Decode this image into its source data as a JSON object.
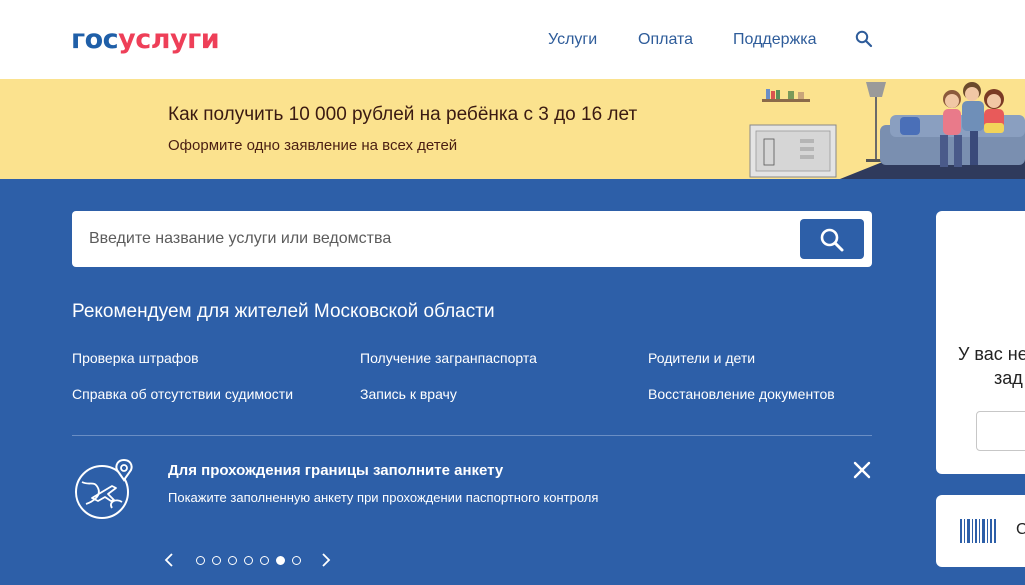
{
  "header": {
    "logo_part1": "гос",
    "logo_part2": "услуги",
    "nav": [
      "Услуги",
      "Оплата",
      "Поддержка"
    ],
    "search_icon": "search-icon"
  },
  "banner": {
    "title": "Как получить 10 000 рублей на ребёнка с 3 до 16 лет",
    "subtitle": "Оформите одно заявление на всех детей",
    "illustration": "family-on-couch-illustration"
  },
  "search": {
    "placeholder": "Введите название услуги или ведомства",
    "button_icon": "search-icon"
  },
  "recommend": {
    "title": "Рекомендуем для жителей Московской области",
    "links": [
      "Проверка штрафов",
      "Получение загранпаспорта",
      "Родители и дети",
      "Справка об отсутствии судимости",
      "Запись к врачу",
      "Восстановление документов"
    ]
  },
  "notice": {
    "icon": "globe-plane-icon",
    "title": "Для прохождения границы заполните анкету",
    "text": "Покажите заполненную анкету при прохождении паспортного контроля",
    "close_icon": "close-icon"
  },
  "carousel": {
    "dots": 7,
    "active_index": 5
  },
  "side": {
    "line1": "У вас не",
    "line2": "зад",
    "card2_text": "С"
  },
  "colors": {
    "brand_blue": "#2d5fa8",
    "logo_red": "#ee3f58",
    "banner_yellow": "#fbe28e"
  }
}
